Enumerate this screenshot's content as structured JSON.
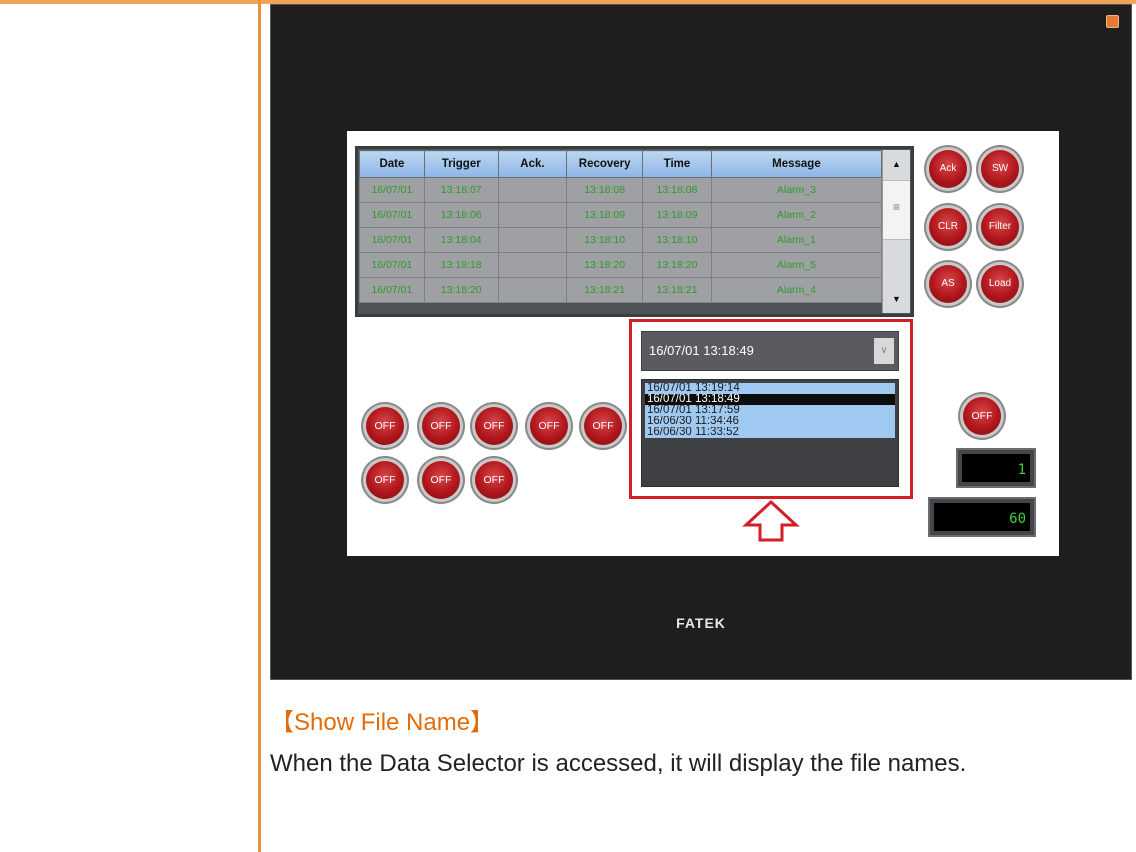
{
  "device": {
    "brand": "FATEK",
    "icon": "settings-icon"
  },
  "alarm_table": {
    "columns": [
      "Date",
      "Trigger",
      "Ack.",
      "Recovery",
      "Time",
      "Message"
    ],
    "rows": [
      [
        "16/07/01",
        "13:18:07",
        "",
        "13:18:08",
        "13:18:08",
        "Alarm_3"
      ],
      [
        "16/07/01",
        "13:18:06",
        "",
        "13:18:09",
        "13:18:09",
        "Alarm_2"
      ],
      [
        "16/07/01",
        "13:18:04",
        "",
        "13:18:10",
        "13:18:10",
        "Alarm_1"
      ],
      [
        "16/07/01",
        "13:18:18",
        "",
        "13:18:20",
        "13:18:20",
        "Alarm_5"
      ],
      [
        "16/07/01",
        "13:18:20",
        "",
        "13:18:21",
        "13:18:21",
        "Alarm_4"
      ]
    ],
    "scroll_up": "▲",
    "scroll_down": "▼",
    "scroll_grip": "≡"
  },
  "side_buttons": [
    "Ack",
    "SW",
    "CLR",
    "Filter",
    "AS",
    "Load"
  ],
  "data_selector": {
    "selected": "16/07/01 13:18:49",
    "dropdown_glyph": "∨",
    "options": [
      "16/07/01 13:19:14",
      "16/07/01 13:18:49",
      "16/07/01 13:17:59",
      "16/06/30 11:34:46",
      "16/06/30 11:33:52"
    ],
    "selected_index": 1
  },
  "toggle_label": "OFF",
  "numeric_displays": [
    "1",
    "60"
  ],
  "doc": {
    "heading": "【Show File Name】",
    "paragraph": "When the Data Selector is accessed, it will display the file names."
  }
}
